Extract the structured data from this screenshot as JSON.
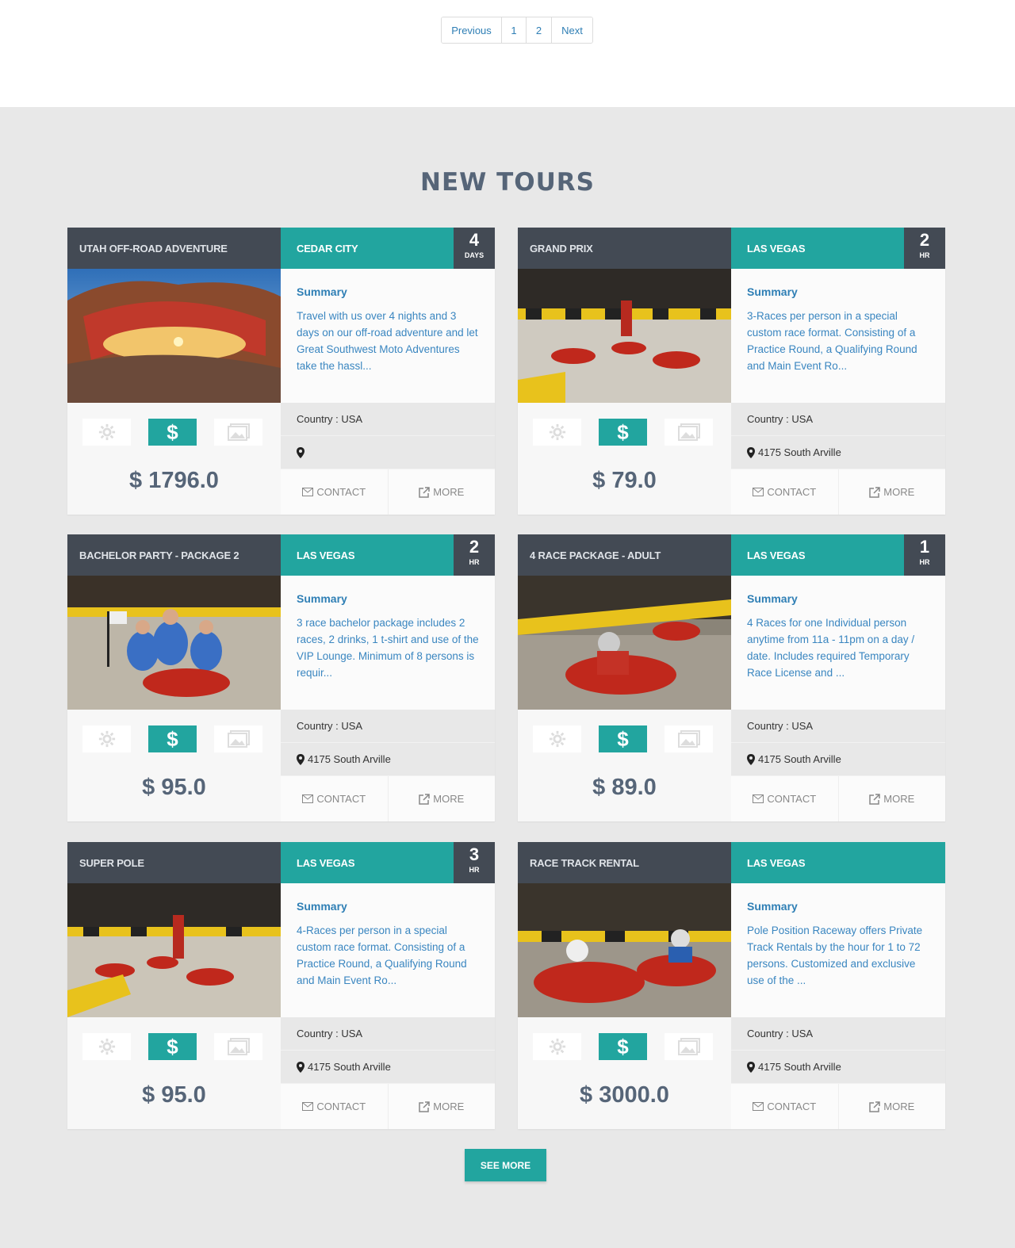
{
  "pagination": {
    "previous": "Previous",
    "page1": "1",
    "page2": "2",
    "next": "Next"
  },
  "section": {
    "title": "NEW TOURS",
    "see_more": "SEE MORE"
  },
  "labels": {
    "summary": "Summary",
    "contact": "CONTACT",
    "more": "MORE"
  },
  "icons": [
    "gear-icon",
    "dollar-icon",
    "gallery-icon",
    "map-marker-icon",
    "envelope-icon",
    "external-link-icon"
  ],
  "colors": {
    "teal": "#22a59f",
    "dark": "#434a54",
    "title": "#566578",
    "link": "#2f7fb5"
  },
  "tours": [
    {
      "name": "UTAH OFF-ROAD ADVENTURE",
      "city": "CEDAR CITY",
      "duration": "4",
      "unit": "DAYS",
      "summary": "Travel with us over 4 nights and 3 days on our off-road adventure and let Great Southwest Moto Adventures take the hassl...",
      "price": "$ 1796.0",
      "country": "Country : USA",
      "address": ""
    },
    {
      "name": "GRAND PRIX",
      "city": "LAS VEGAS",
      "duration": "2",
      "unit": "HR",
      "summary": "3-Races per person in a special custom race format. Consisting of a Practice Round, a Qualifying Round and Main Event Ro...",
      "price": "$ 79.0",
      "country": "Country : USA",
      "address": "4175 South Arville"
    },
    {
      "name": "BACHELOR PARTY - PACKAGE 2",
      "city": "LAS VEGAS",
      "duration": "2",
      "unit": "HR",
      "summary": "3 race bachelor package includes 2 races, 2 drinks, 1 t-shirt and use of the VIP Lounge. Minimum of 8 persons is requir...",
      "price": "$ 95.0",
      "country": "Country : USA",
      "address": "4175 South Arville"
    },
    {
      "name": "4 RACE PACKAGE - ADULT",
      "city": "LAS VEGAS",
      "duration": "1",
      "unit": "HR",
      "summary": "4 Races for one Individual person anytime from 11a - 11pm on a day / date. Includes required Temporary Race License and ...",
      "price": "$ 89.0",
      "country": "Country : USA",
      "address": "4175 South Arville"
    },
    {
      "name": "SUPER POLE",
      "city": "LAS VEGAS",
      "duration": "3",
      "unit": "HR",
      "summary": "4-Races per person in a special custom race format. Consisting of a Practice Round, a Qualifying Round and Main Event Ro...",
      "price": "$ 95.0",
      "country": "Country : USA",
      "address": "4175 South Arville"
    },
    {
      "name": "RACE TRACK RENTAL",
      "city": "LAS VEGAS",
      "duration": "",
      "unit": "",
      "summary": "Pole Position Raceway offers Private Track Rentals by the hour for 1 to 72 persons. Customized and exclusive use of the ...",
      "price": "$ 3000.0",
      "country": "Country : USA",
      "address": "4175 South Arville"
    }
  ]
}
